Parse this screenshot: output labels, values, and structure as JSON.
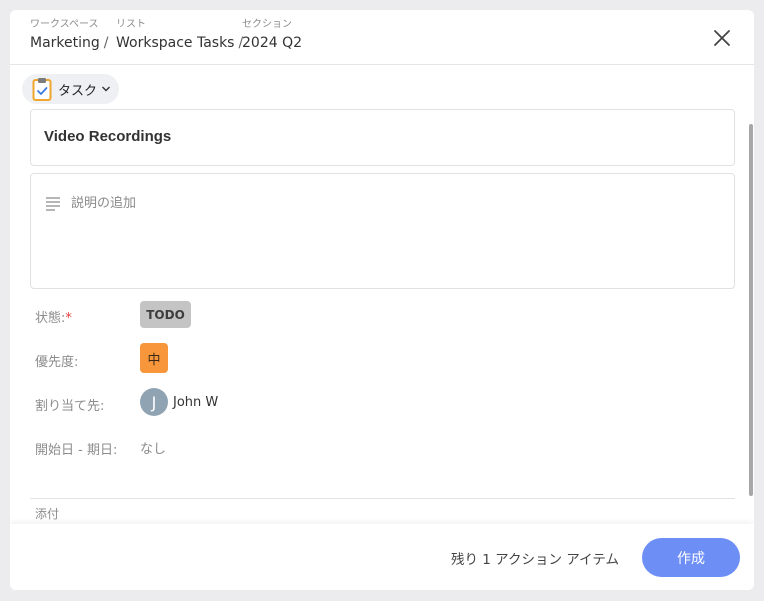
{
  "breadcrumb": [
    {
      "caption": "ワークスペース",
      "value": "Marketing"
    },
    {
      "caption": "リスト",
      "value": "Workspace Tasks"
    },
    {
      "caption": "セクション",
      "value": "2024 Q2"
    }
  ],
  "type_selector": {
    "label": "タスク",
    "icon": "clipboard-check-icon"
  },
  "task": {
    "title": "Video Recordings",
    "description_placeholder": "説明の追加"
  },
  "fields": {
    "status": {
      "label": "状態:",
      "required_mark": "*",
      "value": "TODO"
    },
    "priority": {
      "label": "優先度:",
      "value": "中",
      "color": "#f7963a"
    },
    "assignee": {
      "label": "割り当て先:",
      "initial": "J",
      "name": "John W"
    },
    "dates": {
      "label": "開始日 - 期日:",
      "value": "なし"
    }
  },
  "attachments": {
    "label": "添付"
  },
  "footer": {
    "remaining_text": "残り 1 アクション アイテム",
    "create_label": "作成"
  },
  "colors": {
    "accent": "#6d8ef5",
    "priority": "#f7963a",
    "status_bg": "#c4c4c4"
  }
}
